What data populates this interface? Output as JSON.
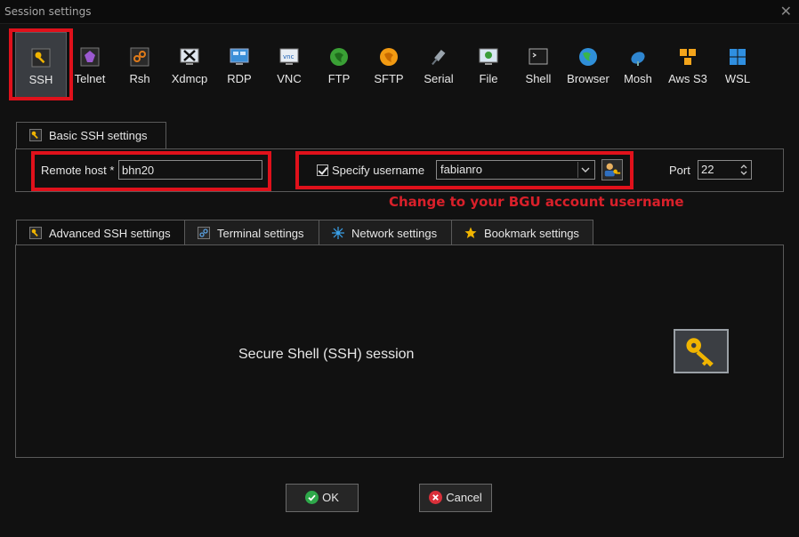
{
  "window": {
    "title": "Session settings",
    "close_glyph": "✕"
  },
  "protocols": [
    {
      "label": "SSH",
      "icon": "key-icon",
      "selected": true
    },
    {
      "label": "Telnet",
      "icon": "telnet-icon"
    },
    {
      "label": "Rsh",
      "icon": "rsh-icon"
    },
    {
      "label": "Xdmcp",
      "icon": "xdmcp-icon"
    },
    {
      "label": "RDP",
      "icon": "rdp-icon"
    },
    {
      "label": "VNC",
      "icon": "vnc-icon"
    },
    {
      "label": "FTP",
      "icon": "ftp-icon"
    },
    {
      "label": "SFTP",
      "icon": "sftp-icon"
    },
    {
      "label": "Serial",
      "icon": "serial-icon"
    },
    {
      "label": "File",
      "icon": "file-icon"
    },
    {
      "label": "Shell",
      "icon": "shell-icon"
    },
    {
      "label": "Browser",
      "icon": "browser-icon"
    },
    {
      "label": "Mosh",
      "icon": "mosh-icon"
    },
    {
      "label": "Aws S3",
      "icon": "aws-s3-icon"
    },
    {
      "label": "WSL",
      "icon": "wsl-icon"
    }
  ],
  "basic": {
    "tab_label": "Basic SSH settings",
    "remote_host_label": "Remote host *",
    "remote_host_value": "bhn20",
    "specify_username_label": "Specify username",
    "specify_username_checked": true,
    "username_value": "fabianro",
    "port_label": "Port",
    "port_value": "22"
  },
  "annotation": "Change to your BGU account username",
  "subtabs": [
    {
      "label": "Advanced SSH settings",
      "icon": "key-icon"
    },
    {
      "label": "Terminal settings",
      "icon": "terminal-icon"
    },
    {
      "label": "Network settings",
      "icon": "network-icon"
    },
    {
      "label": "Bookmark settings",
      "icon": "star-icon"
    }
  ],
  "session_description": "Secure Shell (SSH) session",
  "buttons": {
    "ok": "OK",
    "cancel": "Cancel"
  },
  "colors": {
    "highlight_red": "#e0111b",
    "annotation_red": "#d9202a",
    "ok_green": "#2ea84a",
    "cancel_red": "#d9303a",
    "key_gold": "#f0b400"
  }
}
